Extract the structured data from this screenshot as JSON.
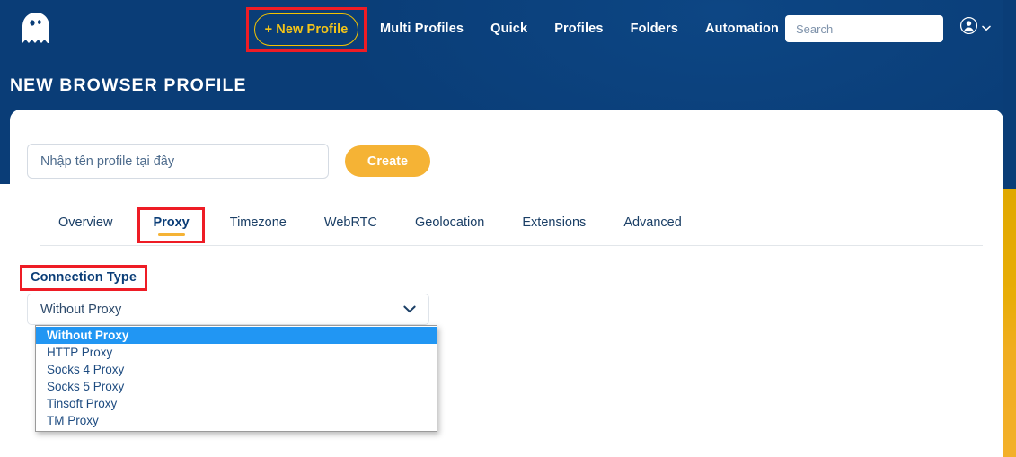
{
  "colors": {
    "brand_blue": "#0a3d77",
    "accent_gold": "#f5b335",
    "annotation_red": "#ee1c25",
    "option_highlight": "#2196f3"
  },
  "header": {
    "logo_name": "ghost-logo",
    "new_profile_label": "+ New Profile",
    "nav_items": [
      {
        "label": "Multi Profiles"
      },
      {
        "label": "Quick"
      },
      {
        "label": "Profiles"
      },
      {
        "label": "Folders"
      },
      {
        "label": "Automation"
      }
    ],
    "search": {
      "value": "",
      "placeholder": "Search"
    },
    "account": {
      "icon": "user-avatar-icon",
      "caret": "chevron-down-icon"
    }
  },
  "page": {
    "title": "NEW BROWSER PROFILE"
  },
  "card": {
    "profile_name": {
      "value": "",
      "placeholder": "Nhập tên profile tại đây"
    },
    "create_label": "Create",
    "tabs": [
      {
        "label": "Overview",
        "active": false
      },
      {
        "label": "Proxy",
        "active": true
      },
      {
        "label": "Timezone",
        "active": false
      },
      {
        "label": "WebRTC",
        "active": false
      },
      {
        "label": "Geolocation",
        "active": false
      },
      {
        "label": "Extensions",
        "active": false
      },
      {
        "label": "Advanced",
        "active": false
      }
    ],
    "connection": {
      "label": "Connection Type",
      "selected": "Without Proxy",
      "options": [
        {
          "label": "Without Proxy",
          "selected": true
        },
        {
          "label": "HTTP Proxy",
          "selected": false
        },
        {
          "label": "Socks 4 Proxy",
          "selected": false
        },
        {
          "label": "Socks 5 Proxy",
          "selected": false
        },
        {
          "label": "Tinsoft Proxy",
          "selected": false
        },
        {
          "label": "TM Proxy",
          "selected": false
        }
      ]
    }
  }
}
